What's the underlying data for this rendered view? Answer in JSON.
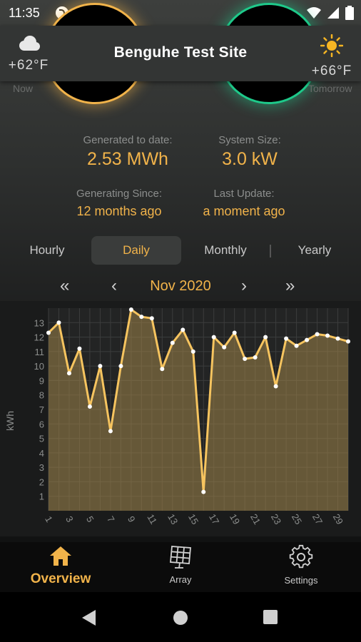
{
  "status_bar": {
    "time": "11:35"
  },
  "header": {
    "title": "Benguhe Test Site",
    "weather_now": {
      "temp": "+62°F",
      "label": "Now",
      "icon": "cloud-icon"
    },
    "weather_tomorrow": {
      "temp": "+66°F",
      "label": "Tomorrow",
      "icon": "sun-icon"
    }
  },
  "stats": {
    "generated_label": "Generated to date:",
    "generated_value": "2.53 MWh",
    "system_size_label": "System Size:",
    "system_size_value": "3.0 kW",
    "since_label": "Generating Since:",
    "since_value": "12 months ago",
    "update_label": "Last Update:",
    "update_value": "a moment ago"
  },
  "tabs": [
    {
      "label": "Hourly",
      "active": false
    },
    {
      "label": "Daily",
      "active": true
    },
    {
      "label": "Monthly",
      "active": false
    },
    {
      "label": "Yearly",
      "active": false
    }
  ],
  "month_nav": {
    "first": "«",
    "prev": "‹",
    "month": "Nov 2020",
    "next": "›",
    "last": "»"
  },
  "colors": {
    "accent": "#f1b34a",
    "green": "#1ec98a"
  },
  "chart_data": {
    "type": "area",
    "ylabel": "kWh",
    "ylim": [
      0,
      14
    ],
    "yticks": [
      1,
      2,
      3,
      4,
      5,
      6,
      7,
      8,
      9,
      10,
      11,
      12,
      13
    ],
    "x": [
      1,
      2,
      3,
      4,
      5,
      6,
      7,
      8,
      9,
      10,
      11,
      12,
      13,
      14,
      15,
      16,
      17,
      18,
      19,
      20,
      21,
      22,
      23,
      24,
      25,
      26,
      27,
      28,
      29,
      30
    ],
    "xtick_labels": [
      "1",
      "3",
      "5",
      "7",
      "9",
      "11",
      "13",
      "15",
      "17",
      "19",
      "21",
      "23",
      "25",
      "27",
      "29"
    ],
    "values": [
      12.3,
      13.0,
      9.5,
      11.2,
      7.2,
      10.0,
      5.5,
      10.0,
      13.9,
      13.4,
      13.3,
      9.8,
      11.6,
      12.5,
      11.0,
      1.3,
      12.0,
      11.3,
      12.3,
      10.5,
      10.6,
      12.0,
      8.6,
      11.9,
      11.4,
      11.8,
      12.2,
      12.1,
      11.9,
      11.7
    ]
  },
  "bottom_nav": [
    {
      "label": "Overview",
      "icon": "home-icon",
      "active": true
    },
    {
      "label": "Array",
      "icon": "solar-panel-icon",
      "active": false
    },
    {
      "label": "Settings",
      "icon": "gear-icon",
      "active": false
    }
  ]
}
